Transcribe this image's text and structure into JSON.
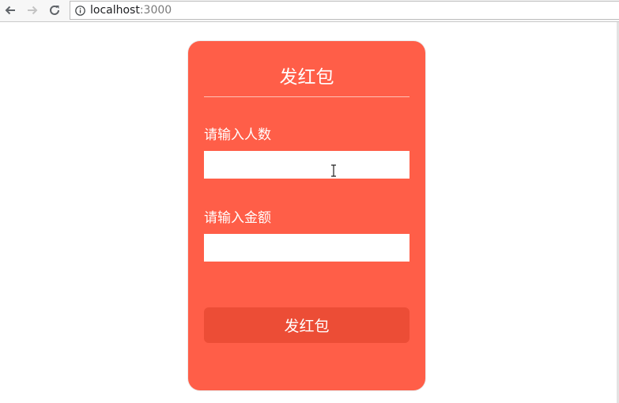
{
  "browser": {
    "url_host": "localhost",
    "url_port": ":3000",
    "icons": {
      "back": "back-arrow-icon",
      "forward": "forward-arrow-icon",
      "reload": "reload-icon",
      "info": "info-icon"
    }
  },
  "card": {
    "title": "发红包",
    "count_label": "请输入人数",
    "count_value": "",
    "amount_label": "请输入金额",
    "amount_value": "",
    "submit_label": "发红包"
  },
  "colors": {
    "card_background": "#ff5e48",
    "button_background": "#ec4d36",
    "text": "#ffffff"
  }
}
